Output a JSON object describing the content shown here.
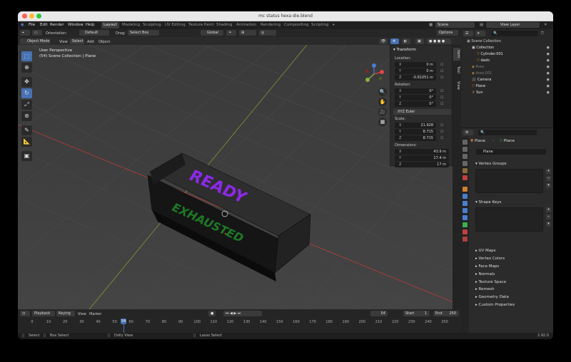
{
  "window": {
    "title": "mc status hexa die.blend"
  },
  "menu": {
    "items": [
      "File",
      "Edit",
      "Render",
      "Window",
      "Help"
    ]
  },
  "workspaces": [
    "Layout",
    "Modeling",
    "Sculpting",
    "UV Editing",
    "Texture Paint",
    "Shading",
    "Animation",
    "Rendering",
    "Compositing",
    "Scripting"
  ],
  "active_workspace": "Layout",
  "topright": {
    "scene": "Scene",
    "view_layer": "View Layer"
  },
  "header": {
    "orientation_label": "Orientation:",
    "orientation_value": "Default",
    "drag_label": "Drag:",
    "drag_value": "Select Box",
    "transform_orientation": "Global",
    "options": "Options"
  },
  "header2": {
    "mode": "Object Mode",
    "view": "View",
    "select": "Select",
    "add": "Add",
    "object": "Object"
  },
  "viewport": {
    "perspective": "User Perspective",
    "collection": "(54) Scene Collection | Plane",
    "ready_text": "READY",
    "exhausted_text": "EXHAUSTED"
  },
  "npanel": {
    "title": "Transform",
    "location_label": "Location:",
    "location": [
      {
        "k": "X",
        "v": "0 m"
      },
      {
        "k": "Y",
        "v": "0 m"
      },
      {
        "k": "Z",
        "v": "-0.81051 m"
      }
    ],
    "rotation_label": "Rotation:",
    "rotation": [
      {
        "k": "X",
        "v": "0°"
      },
      {
        "k": "Y",
        "v": "0°"
      },
      {
        "k": "Z",
        "v": "0°"
      }
    ],
    "rotation_mode": "XYZ Euler",
    "scale_label": "Scale:",
    "scale": [
      {
        "k": "X",
        "v": "21.928"
      },
      {
        "k": "Y",
        "v": "8.715"
      },
      {
        "k": "Z",
        "v": "8.715"
      }
    ],
    "dimensions_label": "Dimensions:",
    "dimensions": [
      {
        "k": "X",
        "v": "43.9 m"
      },
      {
        "k": "Y",
        "v": "17.4 m"
      },
      {
        "k": "Z",
        "v": "17 m"
      }
    ],
    "tabs": [
      "Item",
      "Tool",
      "View"
    ]
  },
  "outliner": {
    "root": "Scene Collection",
    "rows": [
      {
        "name": "Collection",
        "indent": 1,
        "color": "#e6e6e6"
      },
      {
        "name": "Cylinder.001",
        "indent": 2,
        "color": "#e6e6e6"
      },
      {
        "name": "dado",
        "indent": 2,
        "color": "#e6e6e6"
      },
      {
        "name": "Area",
        "indent": 1,
        "color": "#7a7a7a"
      },
      {
        "name": "Area.001",
        "indent": 1,
        "color": "#7a7a7a"
      },
      {
        "name": "Camera",
        "indent": 1,
        "color": "#e6e6e6"
      },
      {
        "name": "Plane",
        "indent": 1,
        "color": "#e6e6e6"
      },
      {
        "name": "Sun",
        "indent": 1,
        "color": "#e6e6e6"
      }
    ]
  },
  "properties": {
    "object": "Plane",
    "mesh": "Plane",
    "data_name": "Plane",
    "panels": [
      "Vertex Groups",
      "Shape Keys",
      "UV Maps",
      "Vertex Colors",
      "Face Maps",
      "Normals",
      "Texture Space",
      "Remesh",
      "Geometry Data",
      "Custom Properties"
    ]
  },
  "timeline": {
    "playback": "Playback",
    "keying": "Keying",
    "view": "View",
    "marker": "Marker",
    "current_frame": "54",
    "start_label": "Start",
    "start": "1",
    "end_label": "End",
    "end": "250",
    "ticks": [
      "0",
      "10",
      "20",
      "30",
      "40",
      "50",
      "60",
      "70",
      "80",
      "90",
      "100",
      "110",
      "120",
      "130",
      "140",
      "150",
      "160",
      "170",
      "180",
      "190",
      "200",
      "210",
      "220",
      "230",
      "240",
      "250"
    ]
  },
  "status": {
    "select": "Select",
    "box_select": "Box Select",
    "dolly": "Dolly View",
    "lasso": "Lasso Select",
    "version": "2.92.0"
  },
  "colors": {
    "accent": "#4772b3",
    "ready": "#8a2be2",
    "exhausted": "#1f8a2a",
    "x_axis": "#c04040",
    "y_axis": "#8ab040"
  }
}
